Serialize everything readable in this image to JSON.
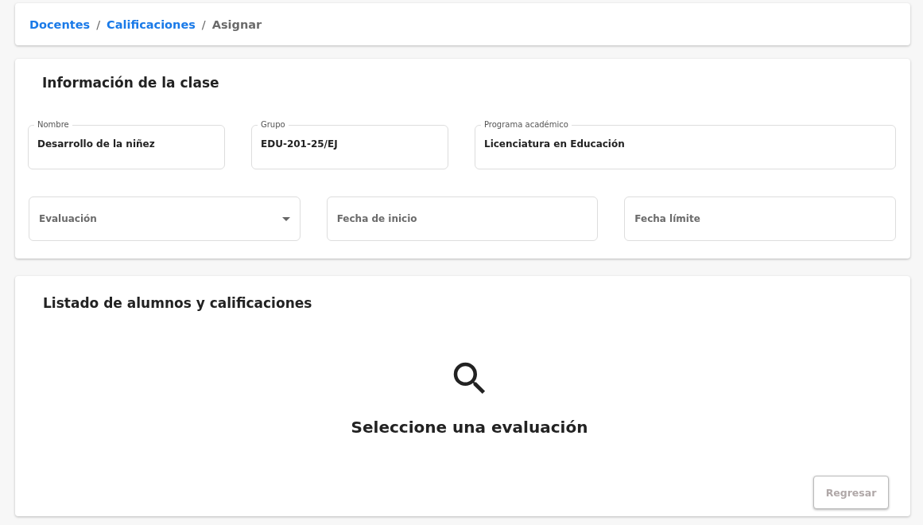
{
  "breadcrumb": [
    {
      "kind": "link",
      "label": "Docentes"
    },
    {
      "kind": "separator",
      "label": "/"
    },
    {
      "kind": "link",
      "label": "Calificaciones"
    },
    {
      "kind": "separator",
      "label": "/"
    },
    {
      "kind": "current",
      "label": "Asignar"
    }
  ],
  "class_info": {
    "title": "Información de la clase",
    "fields": [
      {
        "kind": "readonly",
        "label": "Nombre",
        "value": "Desarrollo de la niñez"
      },
      {
        "kind": "readonly",
        "label": "Grupo",
        "value": "EDU-201-25/EJ"
      },
      {
        "kind": "readonly",
        "label": "Programa académico",
        "value": "Licenciatura en Educación"
      }
    ],
    "filters": [
      {
        "kind": "select",
        "placeholder": "Evaluación"
      },
      {
        "kind": "date",
        "placeholder": "Fecha de inicio"
      },
      {
        "kind": "date",
        "placeholder": "Fecha límite"
      }
    ]
  },
  "students": {
    "title": "Listado de alumnos y calificaciones",
    "empty_message": "Seleccione una evaluación",
    "back_button": {
      "label": "Regresar",
      "disabled": true
    }
  }
}
